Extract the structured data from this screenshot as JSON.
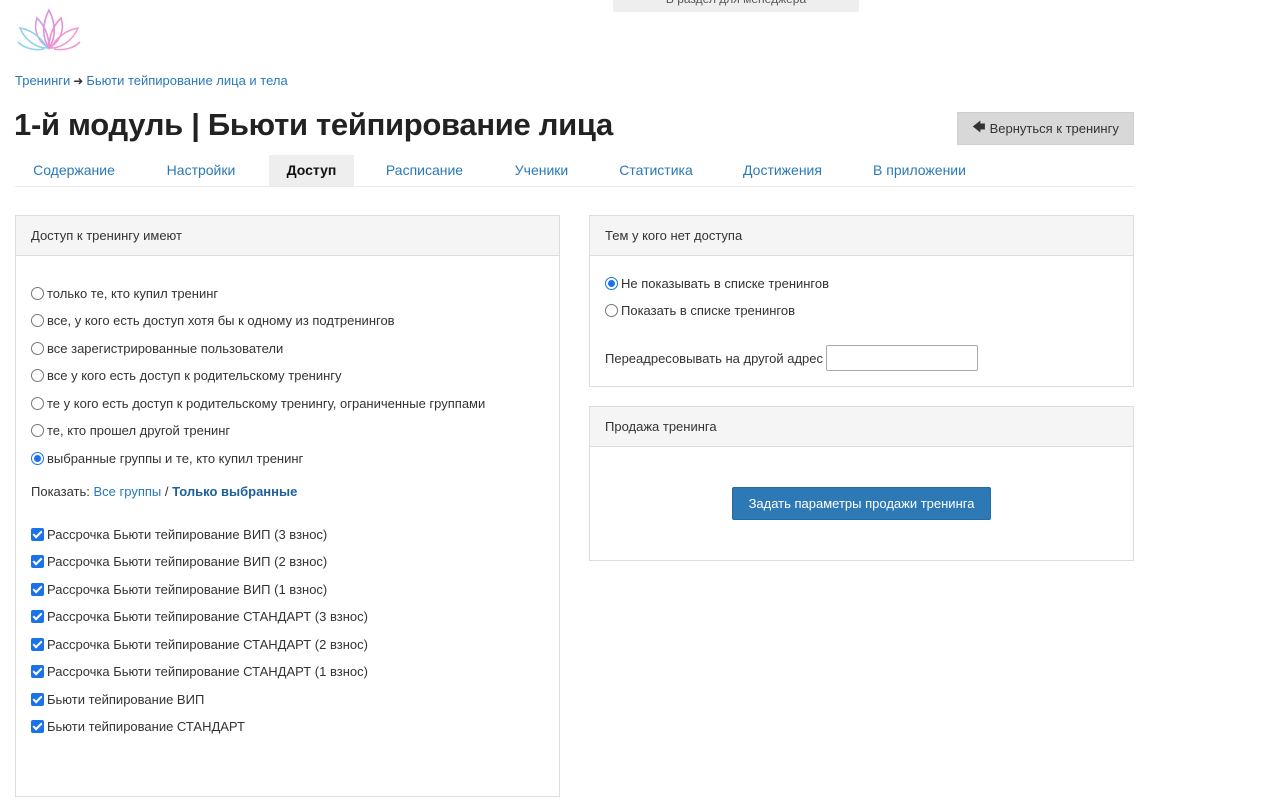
{
  "top_banner": {
    "label": "В раздел для менеджера"
  },
  "breadcrumb": {
    "parent": "Тренинги",
    "separator": "➜",
    "current": "Бьюти тейпирование лица и тела"
  },
  "page": {
    "title": "1-й модуль | Бьюти тейпирование лица"
  },
  "back_button": {
    "label": "Вернуться к тренингу",
    "icon": "arrow-left-icon"
  },
  "tabs": [
    {
      "label": "Содержание"
    },
    {
      "label": "Настройки"
    },
    {
      "label": "Доступ",
      "active": true
    },
    {
      "label": "Расписание"
    },
    {
      "label": "Ученики"
    },
    {
      "label": "Статистика"
    },
    {
      "label": "Достижения"
    },
    {
      "label": "В приложении"
    }
  ],
  "access_panel": {
    "heading": "Доступ к тренингу имеют",
    "options": [
      {
        "label": "только те, кто купил тренинг",
        "checked": false
      },
      {
        "label": "все, у кого есть доступ хотя бы к одному из подтренингов",
        "checked": false
      },
      {
        "label": "все зарегистрированные пользователи",
        "checked": false
      },
      {
        "label": "все у кого есть доступ к родительскому тренингу",
        "checked": false
      },
      {
        "label": "те у кого есть доступ к родительскому тренингу, ограниченные группами",
        "checked": false
      },
      {
        "label": "те, кто прошел другой тренинг",
        "checked": false
      },
      {
        "label": "выбранные группы и те, кто купил тренинг",
        "checked": true
      }
    ],
    "show": {
      "prefix": "Показать:",
      "all_groups": "Все группы",
      "divider": "/",
      "only_selected": "Только выбранные"
    },
    "groups": [
      {
        "label": "Рассрочка Бьюти тейпирование ВИП (3 взнос)",
        "checked": true
      },
      {
        "label": "Рассрочка Бьюти тейпирование ВИП (2 взнос)",
        "checked": true
      },
      {
        "label": "Рассрочка Бьюти тейпирование ВИП (1 взнос)",
        "checked": true
      },
      {
        "label": "Рассрочка Бьюти тейпирование СТАНДАРТ (3 взнос)",
        "checked": true
      },
      {
        "label": "Рассрочка Бьюти тейпирование СТАНДАРТ (2 взнос)",
        "checked": true
      },
      {
        "label": "Рассрочка Бьюти тейпирование СТАНДАРТ (1 взнос)",
        "checked": true
      },
      {
        "label": "Бьюти тейпирование ВИП",
        "checked": true
      },
      {
        "label": "Бьюти тейпирование СТАНДАРТ",
        "checked": true
      }
    ]
  },
  "no_access_panel": {
    "heading": "Тем у кого нет доступа",
    "options": [
      {
        "label": "Не показывать в списке тренингов",
        "checked": true
      },
      {
        "label": "Показать в списке тренингов",
        "checked": false
      }
    ],
    "redirect_label": "Переадресовывать на другой адрес",
    "redirect_value": ""
  },
  "sale_panel": {
    "heading": "Продажа тренинга",
    "button_label": "Задать параметры продажи тренинга"
  },
  "colors": {
    "link": "#2a79b8",
    "primary_button": "#2d79b5",
    "active_tab_bg": "#eeeeee",
    "panel_heading_bg": "#f5f5f5"
  }
}
